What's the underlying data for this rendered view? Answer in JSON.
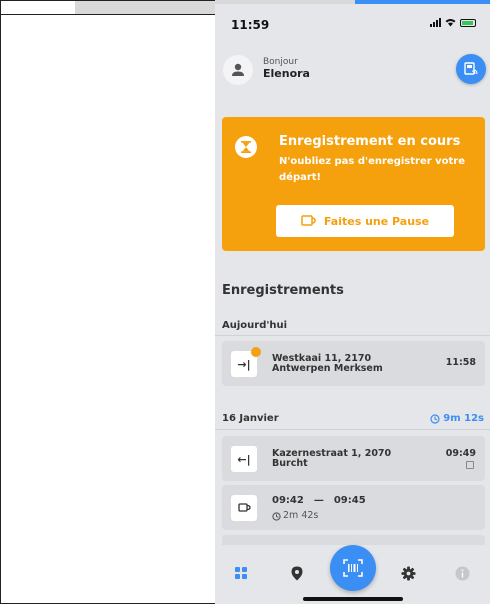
{
  "status_bar": {
    "time": "11:59"
  },
  "header": {
    "greeting": "Bonjour",
    "user_name": "Elenora"
  },
  "status_card": {
    "title": "Enregistrement en cours",
    "message": "N'oubliez pas d'enregistrer votre départ!",
    "pause_label": "Faites une Pause",
    "color": "#f5a00d"
  },
  "registrations": {
    "title": "Enregistrements",
    "today": {
      "label": "Aujourd'hui",
      "entries": [
        {
          "icon": "check-in-icon",
          "address_line1": "Westkaai 11, 2170",
          "address_line2": "Antwerpen Merksem",
          "time": "11:58"
        }
      ]
    },
    "jan16": {
      "label": "16 Janvier",
      "duration": "9m 12s",
      "entries": [
        {
          "icon": "check-out-icon",
          "address_line1": "Kazernestraat 1, 2070",
          "address_line2": "Burcht",
          "time": "09:49"
        },
        {
          "icon": "pause-cup-icon",
          "start": "09:42",
          "separator": "—",
          "end": "09:45",
          "duration": "2m 42s"
        }
      ]
    }
  },
  "colors": {
    "accent": "#3b8ef3",
    "warning": "#f5a00d",
    "background": "#e4e6ea"
  }
}
